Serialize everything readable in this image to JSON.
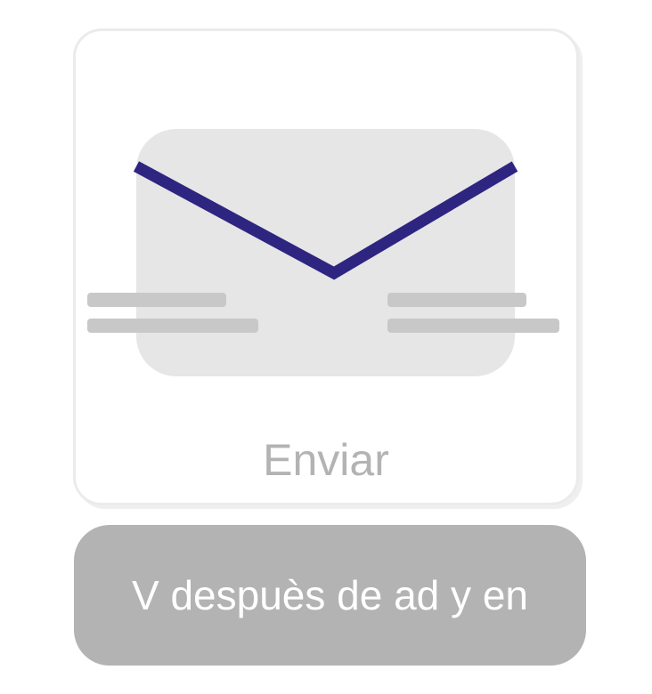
{
  "card": {
    "icon": "send-mail-icon",
    "label": "Enviar"
  },
  "action_button": {
    "label": "V despuès de ad y en"
  },
  "colors": {
    "envelope_body": "#e6e6e6",
    "envelope_flap": "#2e2581",
    "speed_lines": "#c8c8c8",
    "label_text": "#b3b3b3",
    "button_background": "#b3b3b3",
    "button_text": "#ffffff",
    "card_border": "#ebebeb"
  }
}
